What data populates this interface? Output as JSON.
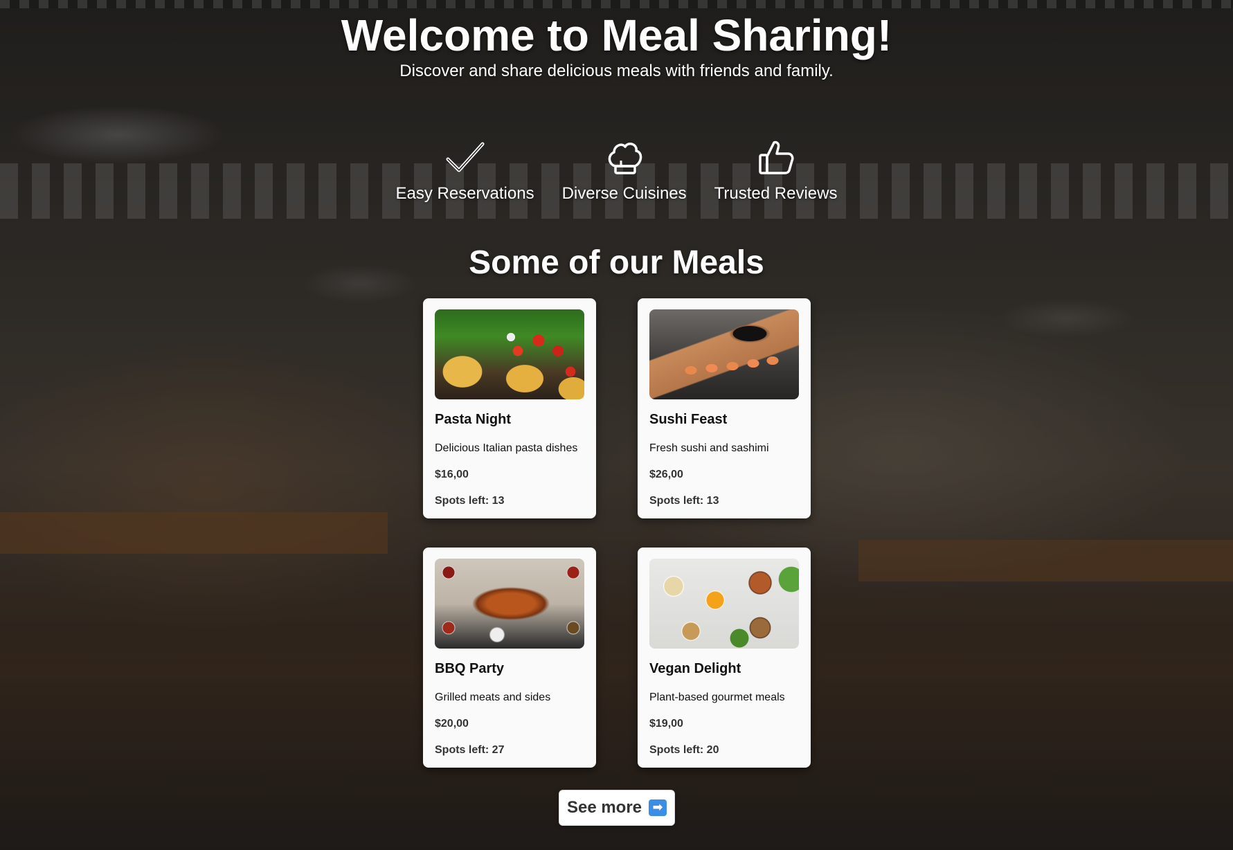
{
  "hero": {
    "title": "Welcome to Meal Sharing!",
    "subtitle": "Discover and share delicious meals with friends and family."
  },
  "features": [
    {
      "label": "Easy Reservations",
      "icon": "checkmark-icon"
    },
    {
      "label": "Diverse Cuisines",
      "icon": "chef-hat-icon"
    },
    {
      "label": "Trusted Reviews",
      "icon": "thumbs-up-icon"
    }
  ],
  "meals_section": {
    "title": "Some of our Meals"
  },
  "meals": [
    {
      "name": "Pasta Night",
      "description": "Delicious Italian pasta dishes",
      "price": "$16,00",
      "spots": "Spots left: 13"
    },
    {
      "name": "Sushi Feast",
      "description": "Fresh sushi and sashimi",
      "price": "$26,00",
      "spots": "Spots left: 13"
    },
    {
      "name": "BBQ Party",
      "description": "Grilled meats and sides",
      "price": "$20,00",
      "spots": "Spots left: 27"
    },
    {
      "name": "Vegan Delight",
      "description": "Plant-based gourmet meals",
      "price": "$19,00",
      "spots": "Spots left: 20"
    }
  ],
  "see_more": {
    "label": "See more",
    "icon": "right-arrow-icon",
    "icon_glyph": "➡"
  }
}
